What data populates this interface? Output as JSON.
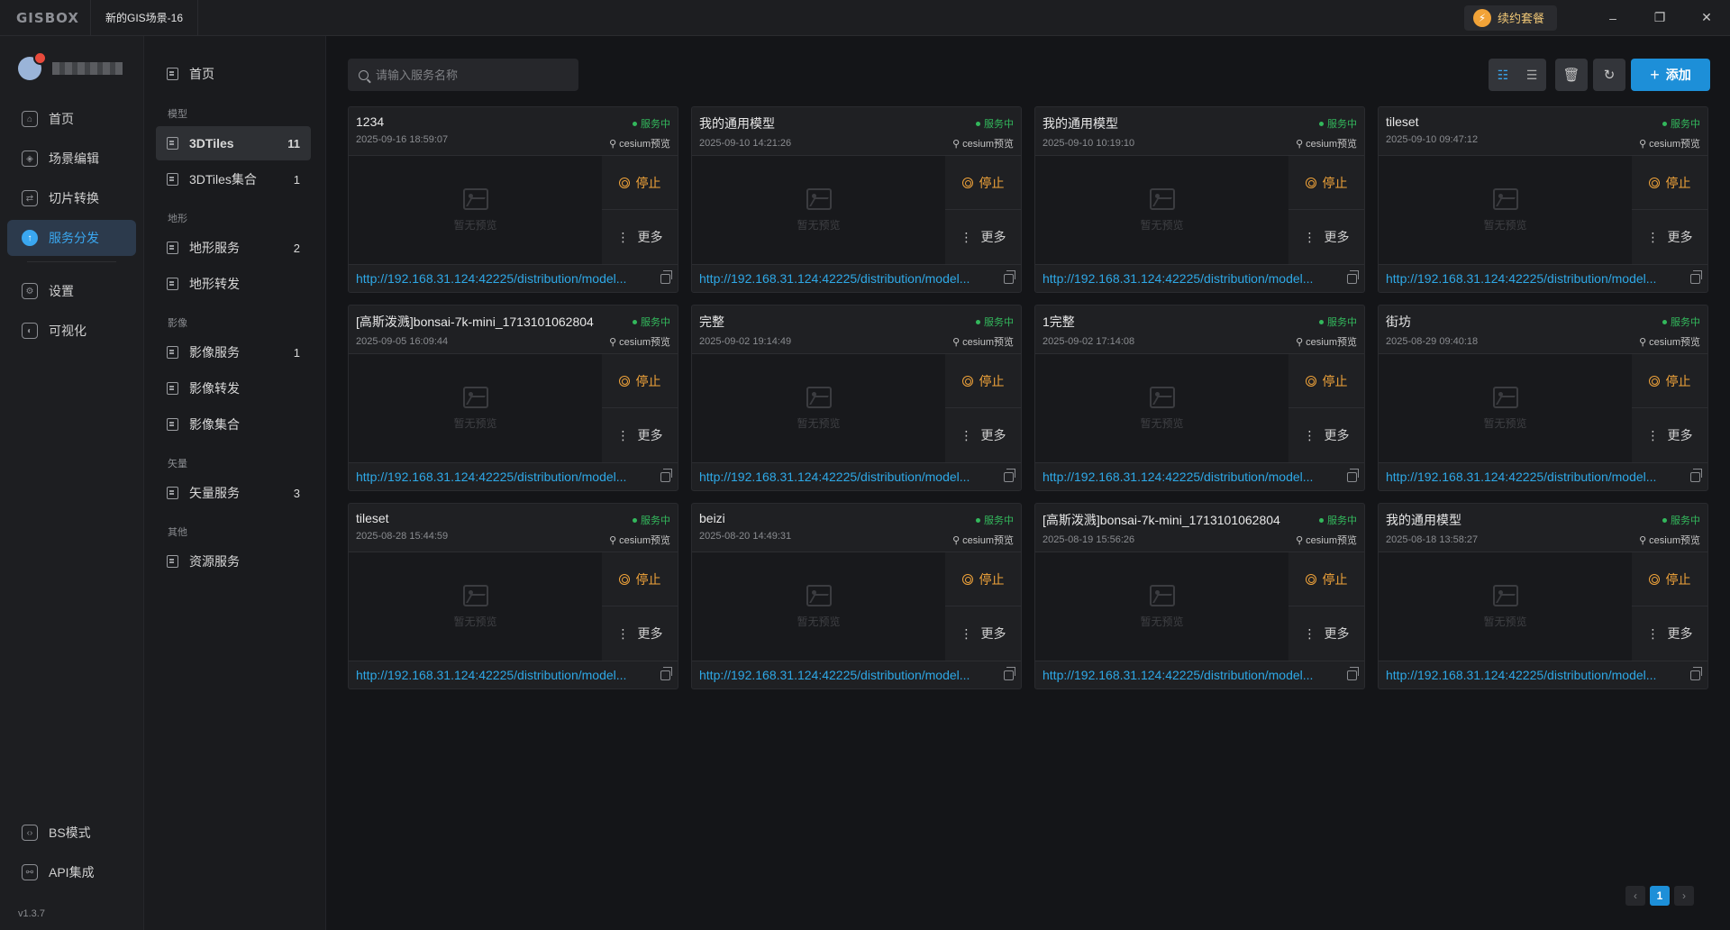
{
  "app": {
    "logo": "GISBOX",
    "tab_title": "新的GIS场景-16",
    "renew_label": "续约套餐",
    "renew_icon": "lightning-icon",
    "version": "v1.3.7",
    "window_controls": [
      "minimize-icon",
      "restore-icon",
      "close-icon"
    ]
  },
  "nav": {
    "items": [
      {
        "label": "首页",
        "icon": "home-icon"
      },
      {
        "label": "场景编辑",
        "icon": "cube-icon"
      },
      {
        "label": "切片转换",
        "icon": "convert-icon"
      },
      {
        "label": "服务分发",
        "icon": "upload-icon",
        "active": true
      },
      {
        "label": "设置",
        "icon": "gear-icon"
      },
      {
        "label": "可视化",
        "icon": "visual-icon"
      }
    ],
    "bottom": [
      {
        "label": "BS模式",
        "icon": "code-icon"
      },
      {
        "label": "API集成",
        "icon": "api-icon"
      }
    ]
  },
  "subnav": {
    "home": "首页",
    "groups": [
      {
        "title": "模型",
        "items": [
          {
            "label": "3DTiles",
            "count": "11",
            "active": true
          },
          {
            "label": "3DTiles集合",
            "count": "1"
          }
        ]
      },
      {
        "title": "地形",
        "items": [
          {
            "label": "地形服务",
            "count": "2"
          },
          {
            "label": "地形转发",
            "count": ""
          }
        ]
      },
      {
        "title": "影像",
        "items": [
          {
            "label": "影像服务",
            "count": "1"
          },
          {
            "label": "影像转发",
            "count": ""
          },
          {
            "label": "影像集合",
            "count": ""
          }
        ]
      },
      {
        "title": "矢量",
        "items": [
          {
            "label": "矢量服务",
            "count": "3"
          }
        ]
      },
      {
        "title": "其他",
        "items": [
          {
            "label": "资源服务",
            "count": ""
          }
        ]
      }
    ]
  },
  "toolbar": {
    "search_placeholder": "请输入服务名称",
    "add_label": "添加"
  },
  "card_common": {
    "status": "服务中",
    "preview": "cesium预览",
    "no_preview": "暂无预览",
    "stop": "停止",
    "more": "更多",
    "url": "http://192.168.31.124:42225/distribution/model..."
  },
  "cards": [
    {
      "name": "1234",
      "date": "2025-09-16 18:59:07"
    },
    {
      "name": "我的通用模型",
      "date": "2025-09-10 14:21:26"
    },
    {
      "name": "我的通用模型",
      "date": "2025-09-10 10:19:10"
    },
    {
      "name": "tileset",
      "date": "2025-09-10 09:47:12"
    },
    {
      "name": "[高斯泼溅]bonsai-7k-mini_1713101062804",
      "date": "2025-09-05 16:09:44"
    },
    {
      "name": "完整",
      "date": "2025-09-02 19:14:49"
    },
    {
      "name": "1完整",
      "date": "2025-09-02 17:14:08"
    },
    {
      "name": "街坊",
      "date": "2025-08-29 09:40:18"
    },
    {
      "name": "tileset",
      "date": "2025-08-28 15:44:59"
    },
    {
      "name": "beizi",
      "date": "2025-08-20 14:49:31"
    },
    {
      "name": "[高斯泼溅]bonsai-7k-mini_1713101062804",
      "date": "2025-08-19 15:56:26"
    },
    {
      "name": "我的通用模型",
      "date": "2025-08-18 13:58:27"
    }
  ],
  "pagination": {
    "current": "1",
    "prev_icon": "chevron-left-icon",
    "next_icon": "chevron-right-icon"
  },
  "colors": {
    "accent": "#1d8fd8",
    "status_green": "#33b85c",
    "stop_orange": "#f0a33a",
    "url_blue": "#2ea8e6"
  }
}
